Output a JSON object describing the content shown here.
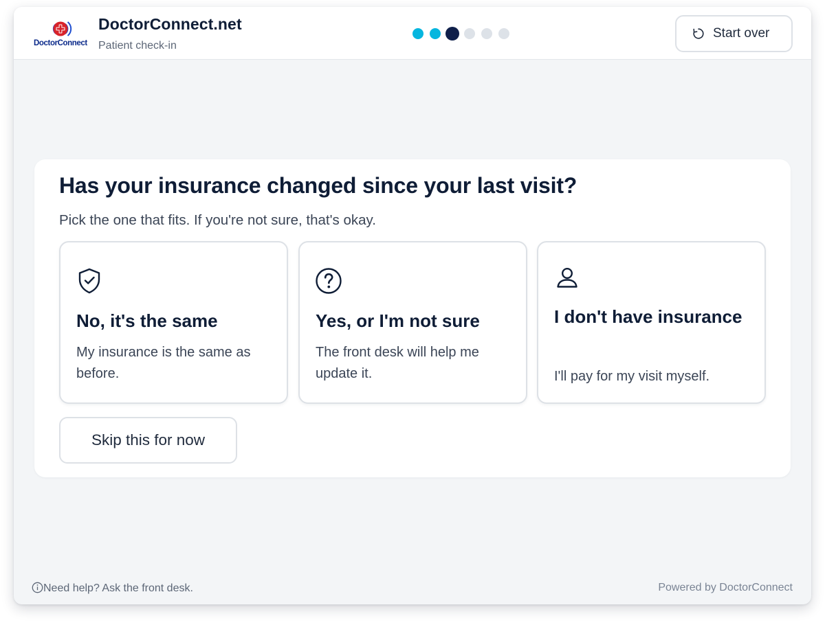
{
  "header": {
    "logo_text": "DoctorConnect",
    "brand_title": "DoctorConnect.net",
    "brand_subtitle": "Patient check-in",
    "progress": {
      "current_step": 3,
      "total_steps": 6
    },
    "start_over_label": "Start over"
  },
  "colors": {
    "accent": "#06b6df",
    "current_step": "#0f1f4a",
    "pending_step": "#dde2e8",
    "text_dark": "#0f1d36"
  },
  "question": {
    "title": "Has your insurance changed since your last visit?",
    "hint": "Pick the one that fits. If you're not sure, that's okay."
  },
  "options": [
    {
      "icon": "shield-check-icon",
      "title": "No, it's the same",
      "description": "My insurance is the same as before."
    },
    {
      "icon": "question-circle-icon",
      "title": "Yes, or I'm not sure",
      "description": "The front desk will help me update it."
    },
    {
      "icon": "person-icon",
      "title": "I don't have insurance",
      "description": "I'll pay for my visit myself."
    }
  ],
  "skip_label": "Skip this for now",
  "footer": {
    "help_text": "Need help? Ask the front desk.",
    "powered_by": "Powered by DoctorConnect"
  }
}
